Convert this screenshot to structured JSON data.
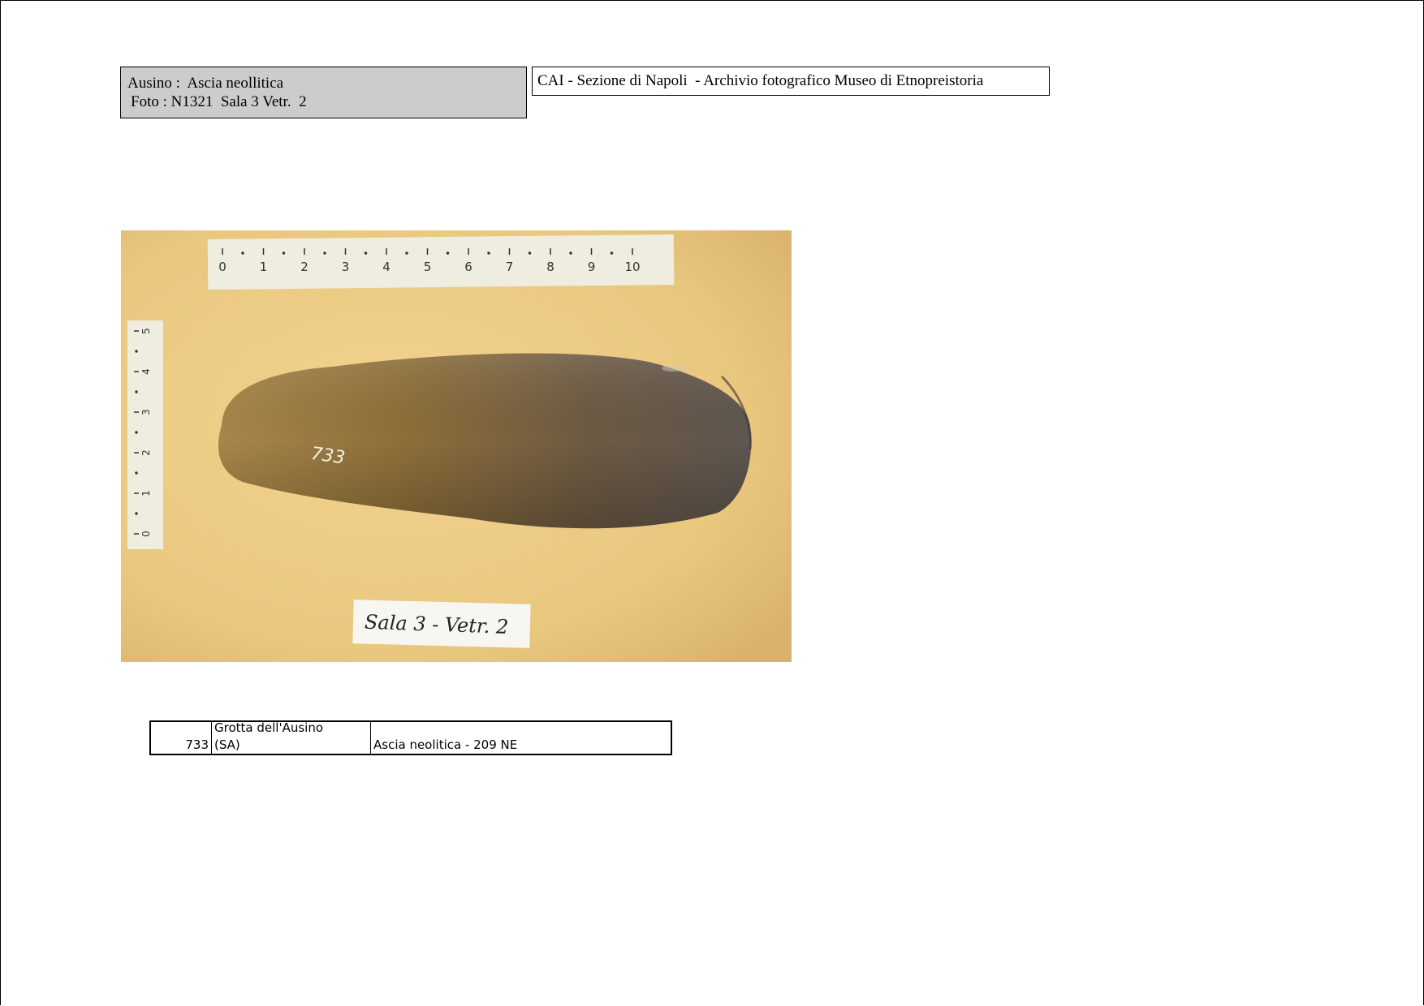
{
  "header": {
    "label_line1": "Ausino :  Ascia neollitica",
    "label_line2": "Foto : N1321  Sala 3 Vetr.  2",
    "archive_title": "CAI - Sezione di Napoli  - Archivio fotografico Museo di Etnopreistoria",
    "label_bg_color": "#cccccc"
  },
  "photo": {
    "ruler_h_marks": [
      "0",
      "1",
      "2",
      "3",
      "4",
      "5",
      "6",
      "7",
      "8",
      "9",
      "10"
    ],
    "ruler_v_marks": [
      "0",
      "1",
      "2",
      "3",
      "4",
      "5"
    ],
    "artifact_number": "733",
    "room_card": "Sala 3 - Vetr. 2"
  },
  "table": {
    "inventory_no": "733",
    "site_line1": "Grotta dell'Ausino",
    "site_line2": "(SA)",
    "description": "Ascia neolitica - 209 NE"
  }
}
